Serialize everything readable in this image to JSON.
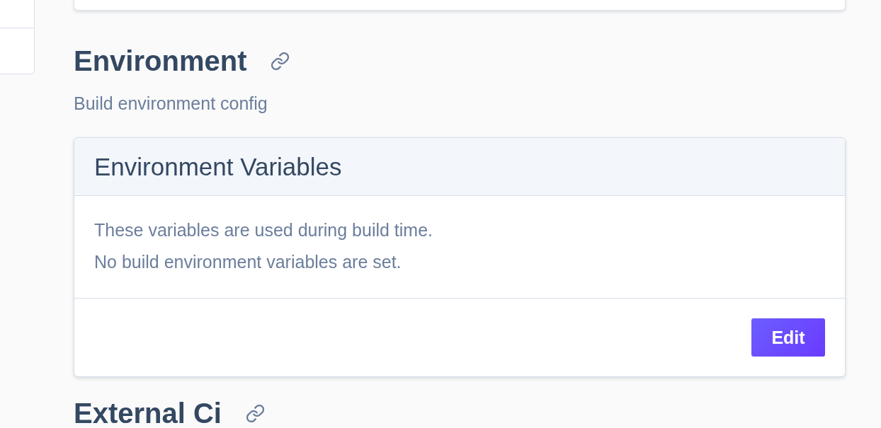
{
  "sections": [
    {
      "title": "Environment",
      "subtitle": "Build environment config",
      "card": {
        "title": "Environment Variables",
        "lines": [
          "These variables are used during build time.",
          "No build environment variables are set."
        ],
        "buttons": [
          "Edit"
        ]
      }
    },
    {
      "title": "External Ci"
    }
  ]
}
